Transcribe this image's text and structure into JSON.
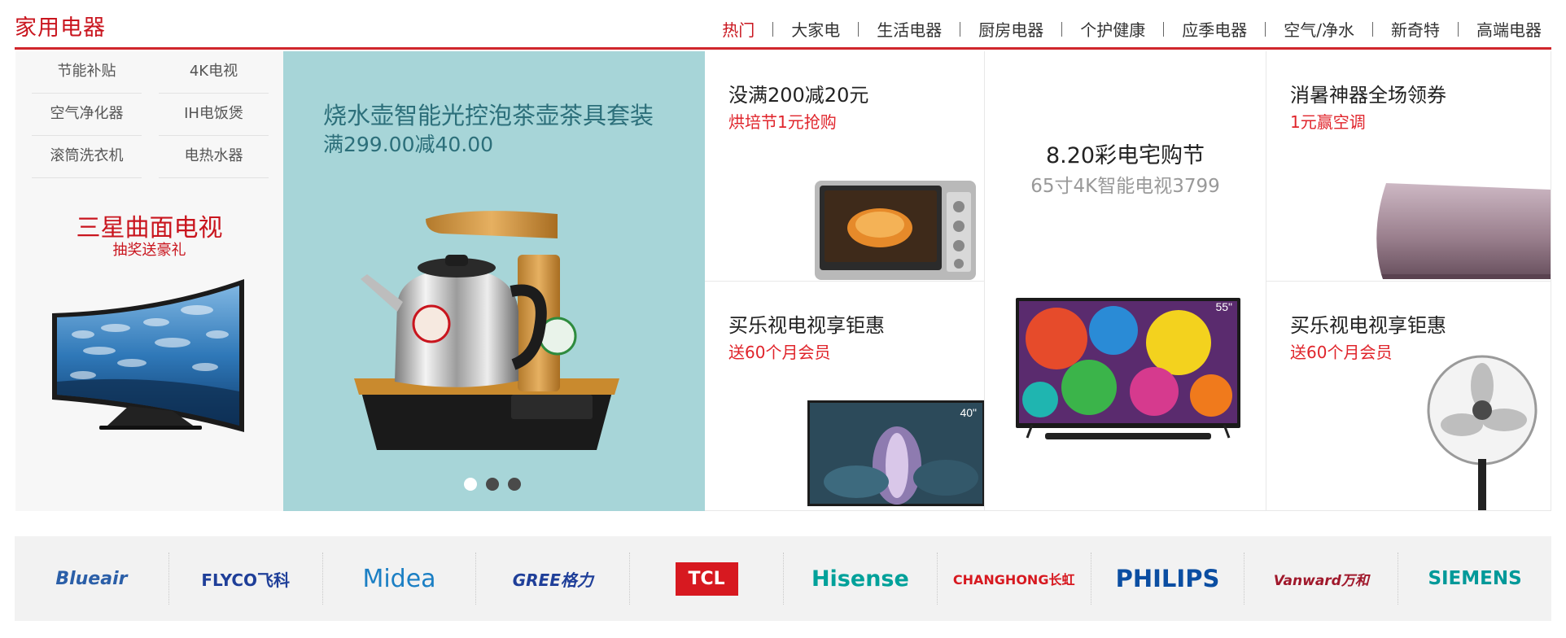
{
  "header": {
    "title": "家用电器",
    "nav": [
      "热门",
      "大家电",
      "生活电器",
      "厨房电器",
      "个护健康",
      "应季电器",
      "空气/净水",
      "新奇特",
      "高端电器"
    ],
    "active_index": 0
  },
  "left": {
    "links": [
      "节能补贴",
      "4K电视",
      "空气净化器",
      "IH电饭煲",
      "滚筒洗衣机",
      "电热水器"
    ],
    "promo_title": "三星曲面电视",
    "promo_sub": "抽奖送豪礼"
  },
  "carousel": {
    "title": "烧水壶智能光控泡茶壶茶具套装",
    "subtitle": "满299.00减40.00",
    "dot_count": 3,
    "active_dot": 0
  },
  "promos": {
    "oven": {
      "title": "没满200减20元",
      "sub": "烘培节1元抢购"
    },
    "center": {
      "title": "8.20彩电宅购节",
      "sub": "65寸4K智能电视3799"
    },
    "aircon": {
      "title": "消暑神器全场领券",
      "sub": "1元赢空调"
    },
    "letv": {
      "title": "买乐视电视享钜惠",
      "sub": "送60个月会员"
    },
    "fan": {
      "title": "买乐视电视享钜惠",
      "sub": "送60个月会员"
    }
  },
  "tv_badges": {
    "center_tv": "55\"",
    "letv_tv": "40\""
  },
  "brands": [
    {
      "name": "Blueair",
      "color": "#2b5fa8"
    },
    {
      "name": "FLYCO飞科",
      "color": "#1f3f99"
    },
    {
      "name": "Midea",
      "color": "#1b7fc4"
    },
    {
      "name": "GREE格力",
      "color": "#1f3f99"
    },
    {
      "name": "TCL",
      "color": "#d71920"
    },
    {
      "name": "Hisense",
      "color": "#00a19a"
    },
    {
      "name": "CHANGHONG长虹",
      "color": "#d71920"
    },
    {
      "name": "PHILIPS",
      "color": "#0b4ea2"
    },
    {
      "name": "Vanward万和",
      "color": "#a0182b"
    },
    {
      "name": "SIEMENS",
      "color": "#009999"
    }
  ]
}
